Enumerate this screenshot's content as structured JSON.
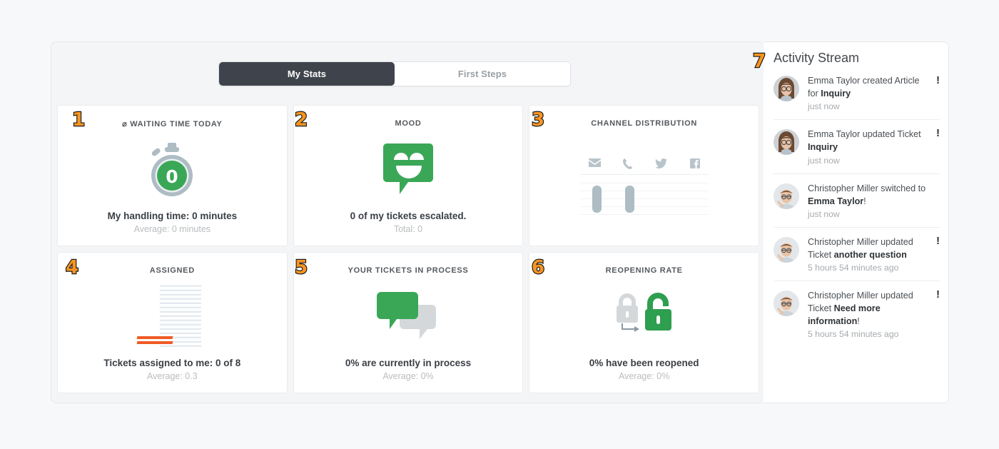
{
  "tabs": [
    {
      "label": "My Stats",
      "active": true
    },
    {
      "label": "First Steps",
      "active": false
    }
  ],
  "badges": [
    "1",
    "2",
    "3",
    "4",
    "5",
    "6",
    "7"
  ],
  "cards": [
    {
      "badge": "1",
      "title": "⌀ Waiting time today",
      "icon": "stopwatch-icon",
      "icon_value": "0",
      "main": "My handling time: 0 minutes",
      "sub": "Average: 0 minutes"
    },
    {
      "badge": "2",
      "title": "Mood",
      "icon": "smiley-speech-bubble-icon",
      "main": "0 of my tickets escalated.",
      "sub": "Total: 0"
    },
    {
      "badge": "3",
      "title": "Channel distribution",
      "icon": "channel-bar-chart-icon",
      "channels": [
        "email-icon",
        "phone-icon",
        "twitter-icon",
        "facebook-icon"
      ],
      "bars": [
        38,
        38
      ],
      "main": "",
      "sub": ""
    },
    {
      "badge": "4",
      "title": "Assigned",
      "icon": "paper-stack-icon",
      "main": "Tickets assigned to me: 0 of 8",
      "sub": "Average: 0.3"
    },
    {
      "badge": "5",
      "title": "Your tickets in process",
      "icon": "double-speech-bubble-icon",
      "main": "0% are currently in process",
      "sub": "Average: 0%"
    },
    {
      "badge": "6",
      "title": "Reopening rate",
      "icon": "unlocked-padlock-icon",
      "main": "0% have been reopened",
      "sub": "Average: 0%"
    }
  ],
  "activity": {
    "title": "Activity Stream",
    "items": [
      {
        "avatar": "avatar-emma-taylor",
        "text_before": "Emma Taylor created Article for ",
        "text_bold": "Inquiry",
        "text_after": "",
        "time": "just now",
        "alert": "!"
      },
      {
        "avatar": "avatar-emma-taylor",
        "text_before": "Emma Taylor updated Ticket ",
        "text_bold": "Inquiry",
        "text_after": "",
        "time": "just now",
        "alert": "!"
      },
      {
        "avatar": "avatar-christopher-miller",
        "text_before": "Christopher Miller switched to ",
        "text_bold": "Emma Taylor",
        "text_after": "!",
        "time": "just now",
        "alert": ""
      },
      {
        "avatar": "avatar-christopher-miller",
        "text_before": "Christopher Miller updated Ticket ",
        "text_bold": "another question",
        "text_after": "",
        "time": "5 hours 54 minutes ago",
        "alert": "!"
      },
      {
        "avatar": "avatar-christopher-miller",
        "text_before": "Christopher Miller updated Ticket ",
        "text_bold": "Need more information",
        "text_after": "!",
        "time": "5 hours 54 minutes ago",
        "alert": "!"
      }
    ]
  },
  "colors": {
    "accent_green": "#3aa757",
    "badge_orange": "#f79521",
    "tab_active_bg": "#3f444c",
    "orange_sheet": "#ef5b25",
    "bar_gray": "#aebcc4"
  }
}
